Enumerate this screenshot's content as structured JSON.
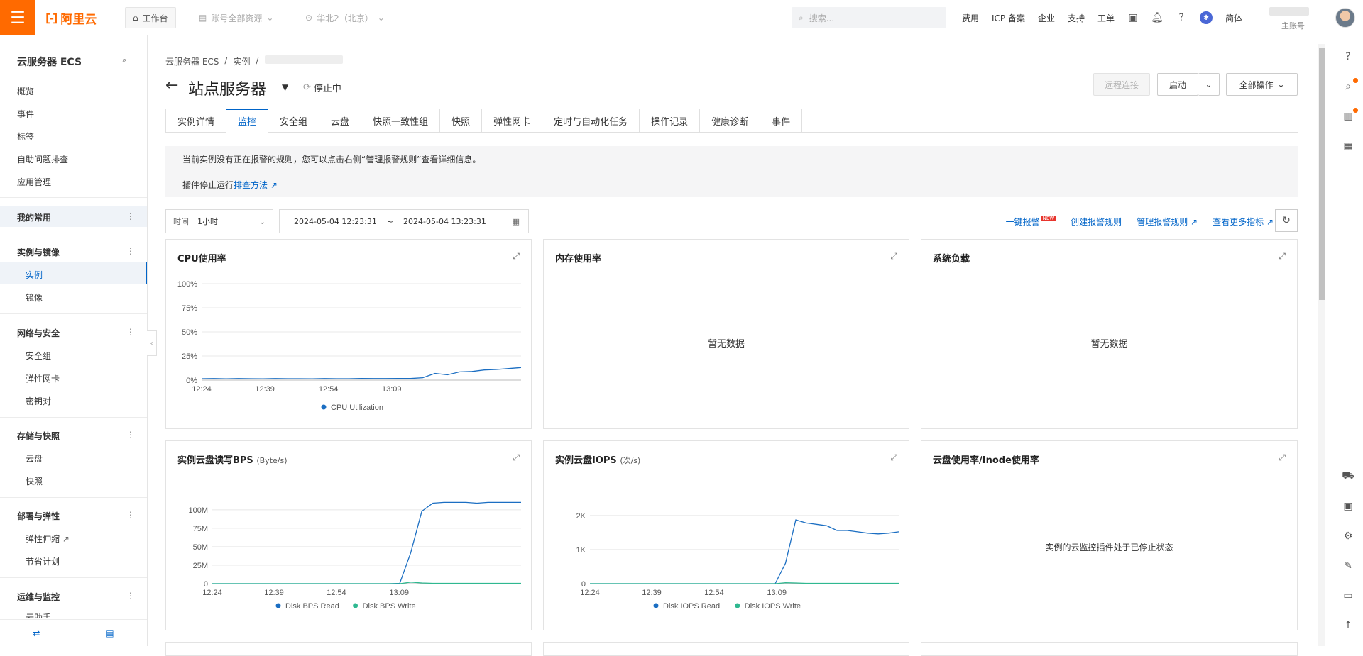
{
  "topbar": {
    "brand": "阿里云",
    "workbench": "工作台",
    "resource": "账号全部资源",
    "region": "华北2（北京）",
    "search_placeholder": "搜索...",
    "links": [
      "费用",
      "ICP 备案",
      "企业",
      "支持",
      "工单"
    ],
    "lang": "简体",
    "account_label": "主账号"
  },
  "sidebar": {
    "title": "云服务器 ECS",
    "top_items": [
      "概览",
      "事件",
      "标签",
      "自助问题排查",
      "应用管理"
    ],
    "favorites": "我的常用",
    "groups": [
      {
        "label": "实例与镜像",
        "items": [
          "实例",
          "镜像"
        ]
      },
      {
        "label": "网络与安全",
        "items": [
          "安全组",
          "弹性网卡",
          "密钥对"
        ]
      },
      {
        "label": "存储与快照",
        "items": [
          "云盘",
          "快照"
        ]
      },
      {
        "label": "部署与弹性",
        "items": [
          "弹性伸缩",
          "节省计划"
        ]
      },
      {
        "label": "运维与监控",
        "items": [
          "云助手"
        ]
      }
    ]
  },
  "page": {
    "breadcrumb": [
      "云服务器 ECS",
      "/",
      "实例",
      "/"
    ],
    "title": "站点服务器",
    "status": "停止中",
    "btn_remote": "远程连接",
    "btn_start": "启动",
    "btn_all": "全部操作",
    "tabs": [
      "实例详情",
      "监控",
      "安全组",
      "云盘",
      "快照一致性组",
      "快照",
      "弹性网卡",
      "定时与自动化任务",
      "操作记录",
      "健康诊断",
      "事件"
    ],
    "notice_line1": "当前实例没有正在报警的规则，您可以点击右侧“管理报警规则”查看详细信息。",
    "notice_line2": "插件停止运行",
    "notice_link": "排查方法",
    "time_label": "时间",
    "time_value": "1小时",
    "time_start": "2024-05-04 12:23:31",
    "time_sep": "~",
    "time_end": "2024-05-04 13:23:31",
    "actions": [
      "一键报警",
      "创建报警规则",
      "管理报警规则",
      "查看更多指标"
    ],
    "new_badge": "NEW"
  },
  "cards": {
    "cpu_title": "CPU使用率",
    "mem_title": "内存使用率",
    "mem_nodata": "暂无数据",
    "load_title": "系统负载",
    "load_nodata": "暂无数据",
    "bps_title": "实例云盘读写BPS",
    "bps_unit": "(Byte/s)",
    "iops_title": "实例云盘IOPS",
    "iops_unit": "(次/s)",
    "disk_title": "云盘使用率/Inode使用率",
    "disk_msg": "实例的云监控插件处于已停止状态"
  },
  "chart_data": [
    {
      "type": "line",
      "title": "CPU使用率",
      "x": [
        "12:24",
        "12:39",
        "12:54",
        "13:09"
      ],
      "y_ticks": [
        "100%",
        "75%",
        "50%",
        "25%",
        "0%"
      ],
      "ylim": [
        0,
        100
      ],
      "series": [
        {
          "name": "CPU Utilization",
          "color": "#1b6ec2",
          "values": [
            1.5,
            1.6,
            1.4,
            1.6,
            1.5,
            1.4,
            1.6,
            1.5,
            1.5,
            1.4,
            1.6,
            1.5,
            1.5,
            1.7,
            1.6,
            1.6,
            1.8,
            1.7,
            2.5,
            7,
            5.5,
            8.5,
            9,
            10.5,
            11,
            12,
            13
          ]
        }
      ]
    },
    {
      "type": "line",
      "title": "实例云盘读写BPS",
      "x": [
        "12:24",
        "12:39",
        "12:54",
        "13:09"
      ],
      "y_ticks": [
        "100M",
        "75M",
        "50M",
        "25M",
        "0"
      ],
      "ylim": [
        0,
        120
      ],
      "series": [
        {
          "name": "Disk BPS Read",
          "color": "#1b6ec2",
          "values": [
            0,
            0,
            0,
            0,
            0,
            0,
            0,
            0,
            0,
            0,
            0,
            0,
            0,
            0,
            0,
            0,
            0,
            0.5,
            42,
            98,
            109,
            110,
            110,
            110,
            109,
            110,
            110,
            110,
            110
          ]
        },
        {
          "name": "Disk BPS Write",
          "color": "#2fb890",
          "values": [
            0,
            0,
            0,
            0,
            0,
            0,
            0,
            0,
            0,
            0,
            0,
            0,
            0,
            0,
            0,
            0,
            0,
            0,
            2,
            1,
            0.5,
            0.5,
            0.5,
            0.5,
            0.5,
            0.5,
            0.5,
            0.5,
            0.5
          ]
        }
      ]
    },
    {
      "type": "line",
      "title": "实例云盘IOPS",
      "x": [
        "12:24",
        "12:39",
        "12:54",
        "13:09"
      ],
      "y_ticks": [
        "2K",
        "1K",
        "0"
      ],
      "ylim": [
        0,
        2600
      ],
      "series": [
        {
          "name": "Disk IOPS Read",
          "color": "#1b6ec2",
          "values": [
            0,
            0,
            0,
            0,
            0,
            0,
            0,
            0,
            0,
            0,
            0,
            0,
            0,
            0,
            0,
            0,
            0,
            0,
            0,
            600,
            1870,
            1780,
            1740,
            1700,
            1560,
            1560,
            1520,
            1480,
            1460,
            1480,
            1520
          ]
        },
        {
          "name": "Disk IOPS Write",
          "color": "#2fb890",
          "values": [
            0,
            0,
            0,
            0,
            0,
            0,
            0,
            0,
            0,
            0,
            0,
            0,
            0,
            0,
            0,
            0,
            0,
            0,
            0,
            30,
            20,
            10,
            10,
            10,
            10,
            10,
            10,
            10,
            10,
            10,
            10
          ]
        }
      ]
    }
  ]
}
